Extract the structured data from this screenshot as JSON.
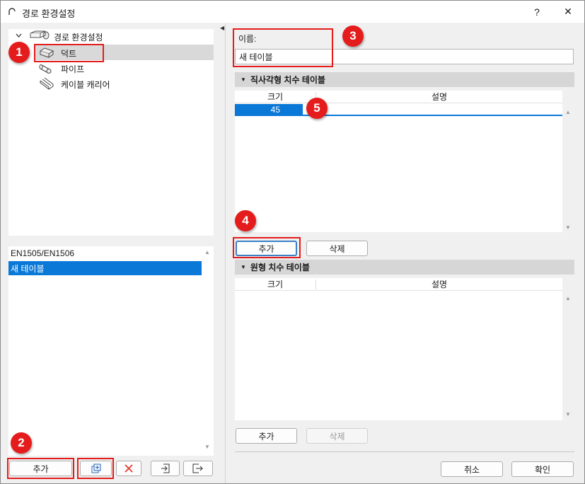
{
  "window": {
    "title": "경로 환경설정",
    "help": "?",
    "close": "✕"
  },
  "tree": {
    "root": "경로 환경설정",
    "items": [
      {
        "label": "덕트",
        "selected": true
      },
      {
        "label": "파이프",
        "selected": false
      },
      {
        "label": "케이블 캐리어",
        "selected": false
      }
    ]
  },
  "table_list": {
    "items": [
      {
        "label": "EN1505/EN1506",
        "selected": false
      },
      {
        "label": "새 테이블",
        "selected": true
      }
    ]
  },
  "left_buttons": {
    "add": "추가"
  },
  "name_field": {
    "label": "이름:",
    "value": "새 테이블"
  },
  "rect_section": {
    "title": "직사각형 치수 테이블",
    "col_size": "크기",
    "col_desc": "설명",
    "rows": [
      {
        "size": "45",
        "desc": ""
      }
    ],
    "add": "추가",
    "delete": "삭제"
  },
  "round_section": {
    "title": "원형 치수 테이블",
    "col_size": "크기",
    "col_desc": "설명",
    "add": "추가",
    "delete": "삭제"
  },
  "footer": {
    "cancel": "취소",
    "ok": "확인"
  },
  "callouts": [
    "1",
    "2",
    "3",
    "4",
    "5"
  ],
  "colors": {
    "accent": "#0a78d7",
    "callout": "#e51c1c",
    "delete_icon": "#e23b2e"
  }
}
